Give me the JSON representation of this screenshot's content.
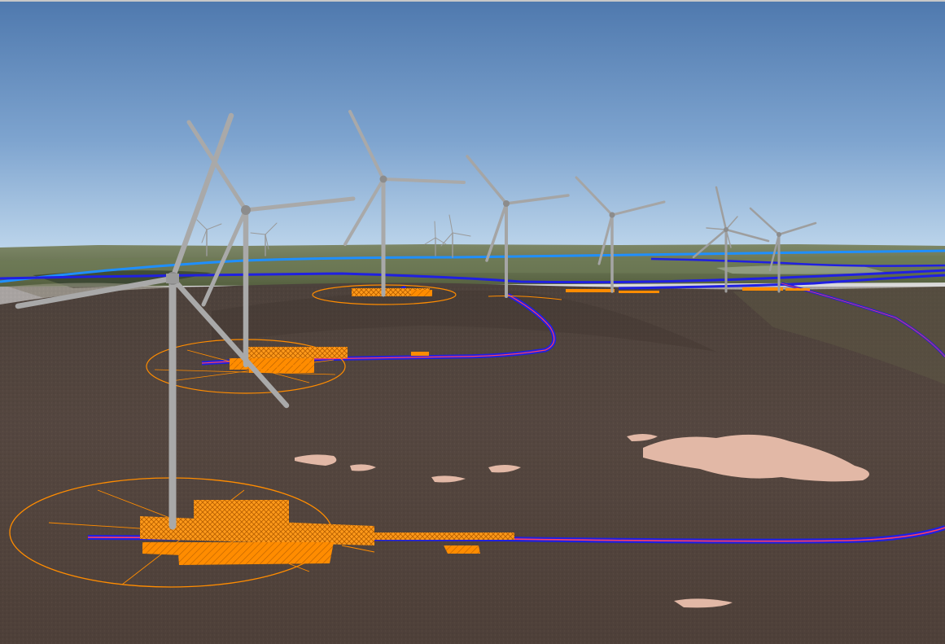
{
  "view": {
    "type": "3d-terrain-view",
    "colors": {
      "sky_top": "#4f79ae",
      "sky_mid": "#7ea4cf",
      "sky_horizon": "#bfd7ec",
      "distant_land": "#6a7555",
      "moorland": "#574840",
      "moorland_dark": "#3f342f",
      "rock_outcrop": "#e2b8a6",
      "turbine": "#a9a9a9",
      "turbine_dark": "#8c8c8c",
      "footprint_fill": "#ff8c00",
      "footprint_line": "#ff8c00",
      "track_outer": "#2020e0",
      "track_inner": "#ff4060",
      "track_far": "#1f8fff"
    }
  },
  "layers": [
    {
      "name": "turbine-models",
      "icon": "wind-turbine-icon"
    },
    {
      "name": "turbine-foundation-and-crane-hardstanding",
      "icon": "hatched-polygon-icon"
    },
    {
      "name": "turbine-rotor-swept-circle",
      "icon": "circle-outline-icon"
    },
    {
      "name": "access-tracks",
      "icon": "polyline-icon"
    },
    {
      "name": "terrain-imagery",
      "icon": "terrain-icon"
    }
  ]
}
